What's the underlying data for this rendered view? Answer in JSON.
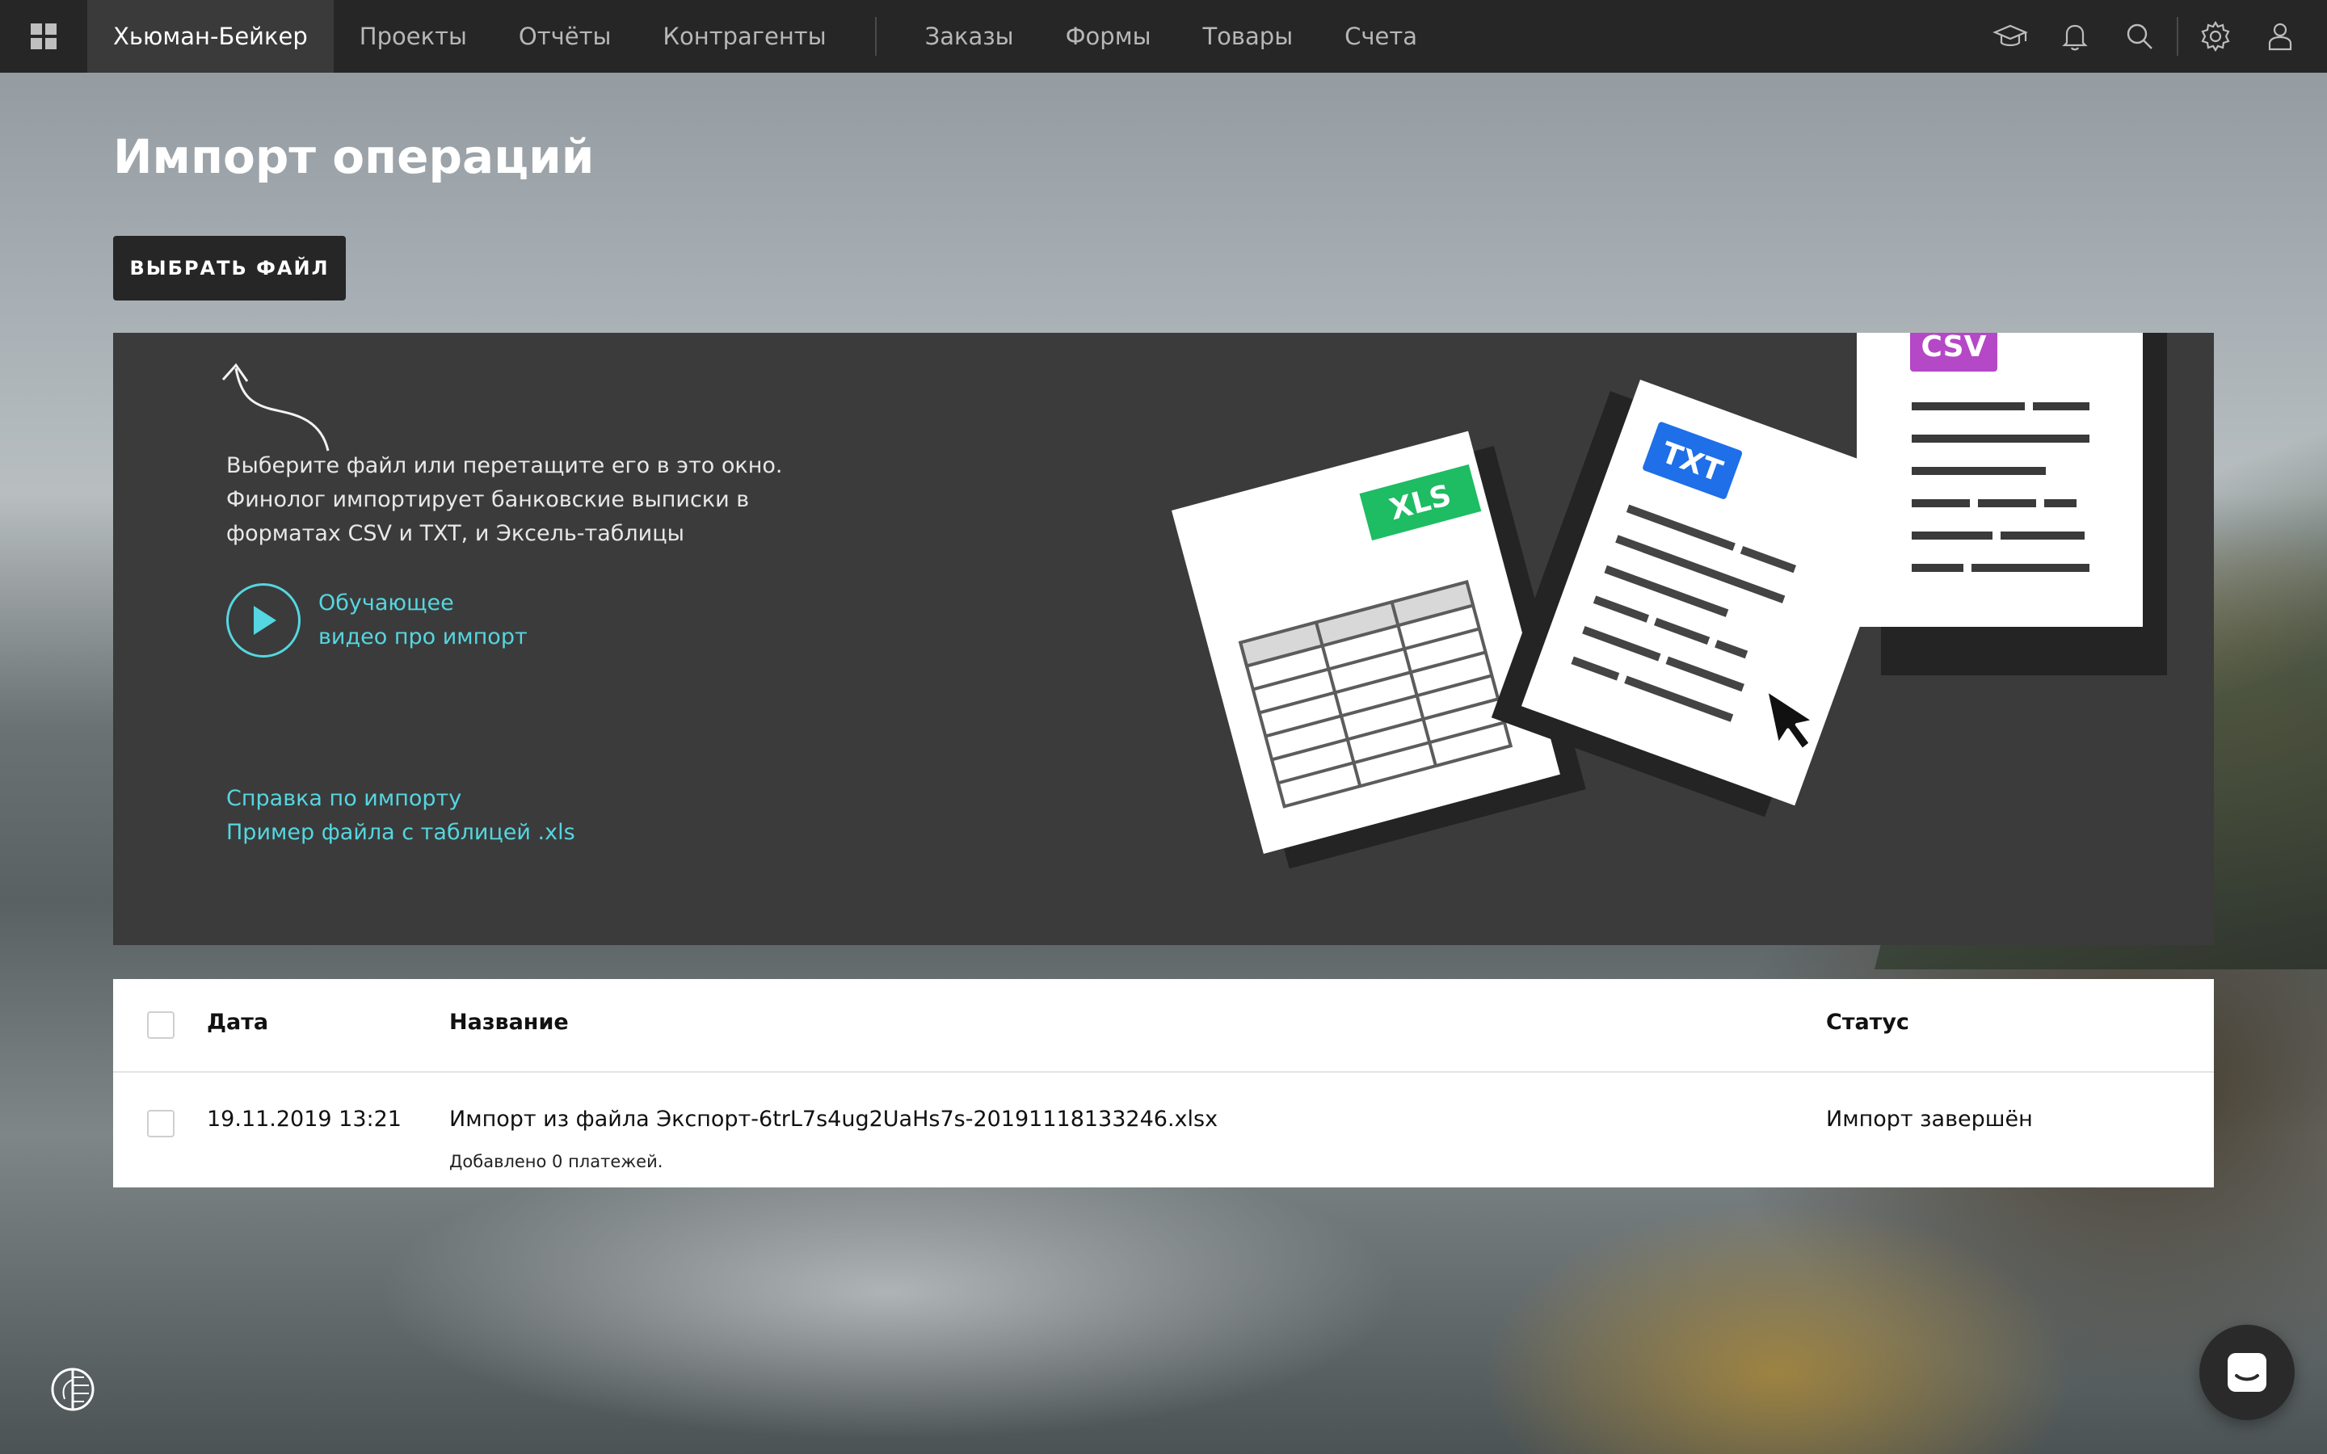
{
  "nav": {
    "company": "Хьюман-Бейкер",
    "items": [
      "Проекты",
      "Отчёты",
      "Контрагенты"
    ],
    "items2": [
      "Заказы",
      "Формы",
      "Товары",
      "Счета"
    ]
  },
  "page": {
    "title": "Импорт операций",
    "choose_button": "ВЫБРАТЬ ФАЙЛ"
  },
  "dropzone": {
    "lines": [
      "Выберите файл или перетащите его в это окно.",
      "Финолог импортирует банковские выписки в",
      "форматах CSV и TXT, и Эксель-таблицы"
    ],
    "video_lines": [
      "Обучающее",
      "видео про импорт"
    ],
    "help_links": [
      "Справка по импорту",
      "Пример файла с таблицей .xls"
    ],
    "badges": {
      "xls": "XLS",
      "txt": "TXT",
      "csv": "CSV"
    },
    "colors": {
      "xls": "#1ebc63",
      "txt": "#1e6fe8",
      "csv": "#b548c6",
      "accent": "#55d6e0"
    }
  },
  "table": {
    "headers": {
      "date": "Дата",
      "name": "Название",
      "status": "Статус"
    },
    "rows": [
      {
        "date": "19.11.2019 13:21",
        "name": "Импорт из файла Экспорт-6trL7s4ug2UaHs7s-20191118133246.xlsx",
        "sub": "Добавлено 0 платежей.",
        "status": "Импорт завершён"
      }
    ]
  }
}
